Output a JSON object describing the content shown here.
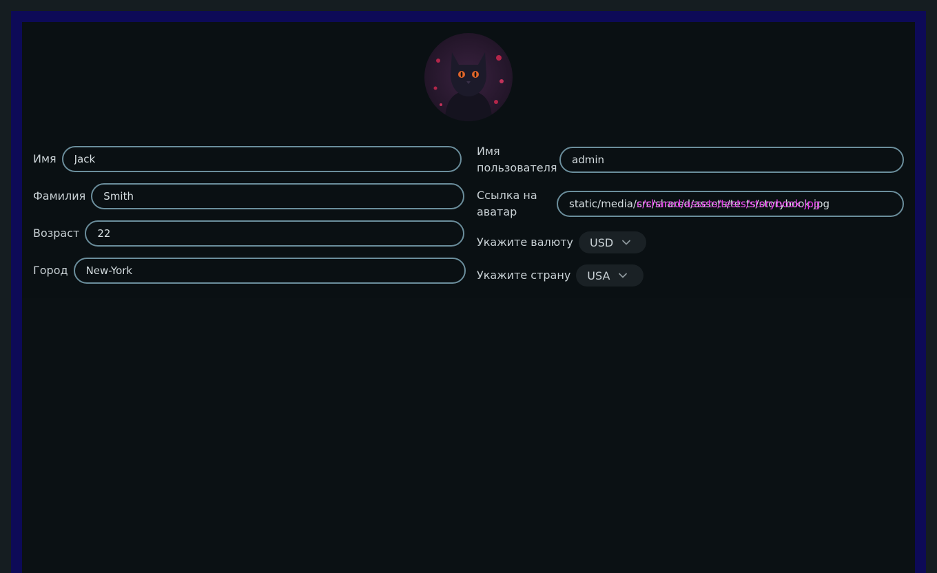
{
  "profile": {
    "avatar_alt": "avatar",
    "first_name": {
      "label": "Имя",
      "value": "Jack"
    },
    "last_name": {
      "label": "Фамилия",
      "value": "Smith"
    },
    "age": {
      "label": "Возраст",
      "value": "22"
    },
    "city": {
      "label": "Город",
      "value": "New-York"
    },
    "username": {
      "label": "Имя пользователя",
      "value": "admin"
    },
    "avatar_link": {
      "label": "Ссылка на аватар",
      "value": "static/media/src/shared/assets/tests/storybook.jpg",
      "overlay": "c/shared/assets/tests/storybook.jpg"
    },
    "currency": {
      "label": "Укажите валюту",
      "value": "USD"
    },
    "country": {
      "label": "Укажите страну",
      "value": "USA"
    }
  },
  "colors": {
    "frame": "#0d0a57",
    "page_bg": "#0b1114",
    "input_border": "#6b8e9c",
    "overlay_text": "#e23ae6"
  }
}
